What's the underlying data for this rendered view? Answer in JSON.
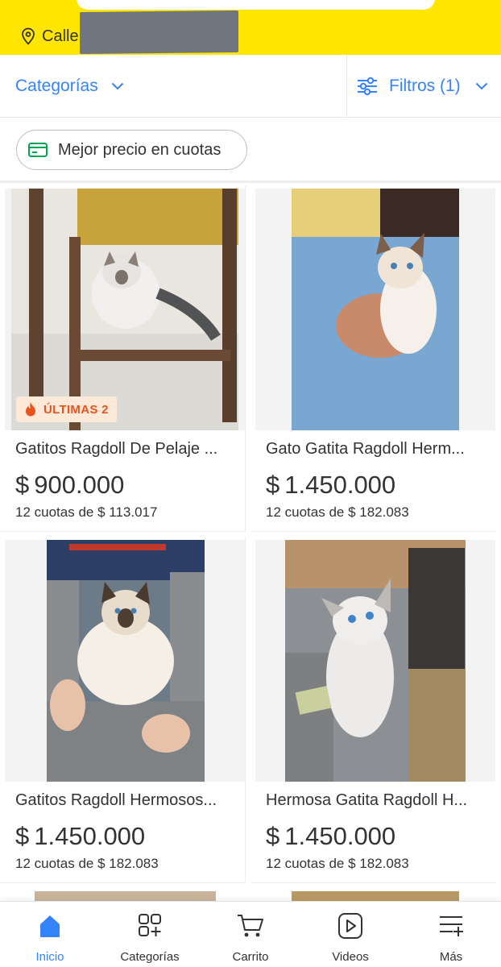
{
  "header": {
    "address_label": "Calle",
    "address_redacted": true,
    "bg_color": "#ffe600"
  },
  "filters": {
    "categories_label": "Categorías",
    "filters_label": "Filtros (1)",
    "accent_color": "#3483fa"
  },
  "chip": {
    "label": "Mejor precio en cuotas",
    "icon": "credit-card-icon"
  },
  "products": [
    {
      "title": "Gatitos Ragdoll De Pelaje ...",
      "currency": "$",
      "price": "900.000",
      "installments": "12 cuotas de $ 113.017",
      "badge": "ÚLTIMAS 2"
    },
    {
      "title": "Gato Gatita Ragdoll Herm...",
      "currency": "$",
      "price": "1.450.000",
      "installments": "12 cuotas de $ 182.083"
    },
    {
      "title": "Gatitos Ragdoll Hermosos...",
      "currency": "$",
      "price": "1.450.000",
      "installments": "12 cuotas de $ 182.083"
    },
    {
      "title": "Hermosa Gatita Ragdoll H...",
      "currency": "$",
      "price": "1.450.000",
      "installments": "12 cuotas de $ 182.083"
    }
  ],
  "bottom_nav": [
    {
      "label": "Inicio",
      "icon": "home-icon",
      "active": true
    },
    {
      "label": "Categorías",
      "icon": "categories-icon",
      "active": false
    },
    {
      "label": "Carrito",
      "icon": "cart-icon",
      "active": false
    },
    {
      "label": "Videos",
      "icon": "video-icon",
      "active": false
    },
    {
      "label": "Más",
      "icon": "more-icon",
      "active": false
    }
  ]
}
